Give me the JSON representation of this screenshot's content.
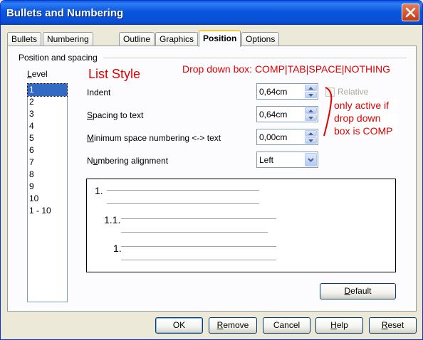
{
  "window": {
    "title": "Bullets and Numbering"
  },
  "tabs": [
    {
      "label": "Bullets",
      "active": false
    },
    {
      "label": "Numbering type",
      "active": false
    },
    {
      "label": "Outline",
      "active": false
    },
    {
      "label": "Graphics",
      "active": false
    },
    {
      "label": "Position",
      "active": true
    },
    {
      "label": "Options",
      "active": false
    }
  ],
  "group": {
    "label": "Position and spacing"
  },
  "level": {
    "label": "Level",
    "items": [
      "1",
      "2",
      "3",
      "4",
      "5",
      "6",
      "7",
      "8",
      "9",
      "10",
      "1 - 10"
    ],
    "selected": "1"
  },
  "annotations": {
    "list_style": "List Style",
    "dropdown_note": "Drop down box: COMP|TAB|SPACE|NOTHING",
    "relative_note_1": "only active if",
    "relative_note_2": "drop down",
    "relative_note_3": "box is COMP",
    "color": "#e00000"
  },
  "fields": {
    "indent": {
      "label": "Indent",
      "value": "0,64cm"
    },
    "spacing_to_text": {
      "label": "Spacing to text",
      "value": "0,64cm"
    },
    "min_space": {
      "label": "Minimum space numbering <-> text",
      "value": "0,00cm"
    },
    "numbering_alignment": {
      "label": "Numbering alignment",
      "value": "Left"
    }
  },
  "relative": {
    "label": "Relative",
    "checked": false,
    "enabled": false
  },
  "preview": {
    "items": [
      "1.",
      "1.1.",
      "1."
    ]
  },
  "buttons": {
    "default": "Default",
    "ok": "OK",
    "remove": "Remove",
    "cancel": "Cancel",
    "help": "Help",
    "reset": "Reset"
  },
  "icons": {
    "close": "close-icon",
    "spin_up": "arrow-up-icon",
    "spin_down": "arrow-down-icon",
    "dropdown": "chevron-down-icon"
  }
}
